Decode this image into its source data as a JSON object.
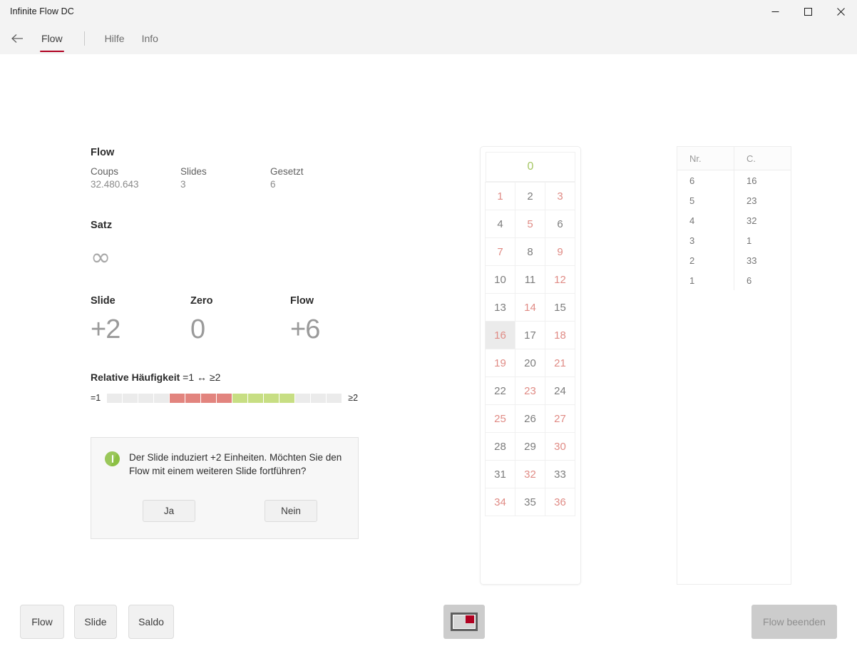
{
  "window": {
    "title": "Infinite Flow DC",
    "controls": [
      {
        "name": "minimize",
        "glyph": "minimize-icon"
      },
      {
        "name": "maximize",
        "glyph": "maximize-icon"
      },
      {
        "name": "close",
        "glyph": "close-icon"
      }
    ]
  },
  "nav": {
    "back_icon": "back-arrow-icon",
    "tabs": [
      {
        "label": "Flow",
        "active": true
      },
      {
        "label": "Hilfe",
        "active": false
      },
      {
        "label": "Info",
        "active": false
      }
    ],
    "accent_color": "#b00020"
  },
  "flow_section": {
    "title": "Flow",
    "stats": [
      {
        "label": "Coups",
        "value": "32.480.643"
      },
      {
        "label": "Slides",
        "value": "3"
      },
      {
        "label": "Gesetzt",
        "value": "6"
      }
    ]
  },
  "satz_section": {
    "title": "Satz",
    "value": "∞",
    "value_icon": "infinity-icon"
  },
  "metrics": [
    {
      "label": "Slide",
      "value": "+2"
    },
    {
      "label": "Zero",
      "value": "0"
    },
    {
      "label": "Flow",
      "value": "+6"
    }
  ],
  "frequency": {
    "title_bold": "Relative Häufigkeit",
    "title_rest": "=1 ↔ ≥2",
    "left_label": "=1",
    "right_label": "≥2",
    "segments": [
      "gray",
      "gray",
      "gray",
      "gray",
      "red",
      "red",
      "red",
      "red",
      "green",
      "green",
      "green",
      "green",
      "gray",
      "gray",
      "gray"
    ],
    "colors": {
      "gray": "#ebebeb",
      "red": "#e2847e",
      "green": "#c7de83"
    }
  },
  "dialog": {
    "icon": "info-icon",
    "message": "Der Slide induziert +2 Einheiten. Möchten Sie den Flow mit einem weiteren Slide fortführen?",
    "yes_label": "Ja",
    "no_label": "Nein"
  },
  "roulette": {
    "zero": {
      "value": "0",
      "color_class": "green"
    },
    "rows": [
      [
        {
          "value": "1",
          "color": "red"
        },
        {
          "value": "2",
          "color": "black"
        },
        {
          "value": "3",
          "color": "red"
        }
      ],
      [
        {
          "value": "4",
          "color": "black"
        },
        {
          "value": "5",
          "color": "red"
        },
        {
          "value": "6",
          "color": "black"
        }
      ],
      [
        {
          "value": "7",
          "color": "red"
        },
        {
          "value": "8",
          "color": "black"
        },
        {
          "value": "9",
          "color": "red"
        }
      ],
      [
        {
          "value": "10",
          "color": "black"
        },
        {
          "value": "11",
          "color": "black"
        },
        {
          "value": "12",
          "color": "red"
        }
      ],
      [
        {
          "value": "13",
          "color": "black"
        },
        {
          "value": "14",
          "color": "red"
        },
        {
          "value": "15",
          "color": "black"
        }
      ],
      [
        {
          "value": "16",
          "color": "red",
          "highlighted": true
        },
        {
          "value": "17",
          "color": "black"
        },
        {
          "value": "18",
          "color": "red"
        }
      ],
      [
        {
          "value": "19",
          "color": "red"
        },
        {
          "value": "20",
          "color": "black"
        },
        {
          "value": "21",
          "color": "red"
        }
      ],
      [
        {
          "value": "22",
          "color": "black"
        },
        {
          "value": "23",
          "color": "red"
        },
        {
          "value": "24",
          "color": "black"
        }
      ],
      [
        {
          "value": "25",
          "color": "red"
        },
        {
          "value": "26",
          "color": "black"
        },
        {
          "value": "27",
          "color": "red"
        }
      ],
      [
        {
          "value": "28",
          "color": "black"
        },
        {
          "value": "29",
          "color": "black"
        },
        {
          "value": "30",
          "color": "red"
        }
      ],
      [
        {
          "value": "31",
          "color": "black"
        },
        {
          "value": "32",
          "color": "red"
        },
        {
          "value": "33",
          "color": "black"
        }
      ],
      [
        {
          "value": "34",
          "color": "red"
        },
        {
          "value": "35",
          "color": "black"
        },
        {
          "value": "36",
          "color": "red"
        }
      ]
    ],
    "red_color": "#e08b85",
    "black_color": "#7c7c7c",
    "zero_color": "#a5c663"
  },
  "history": {
    "headers": [
      "Nr.",
      "C."
    ],
    "rows": [
      {
        "nr": "6",
        "c": "16"
      },
      {
        "nr": "5",
        "c": "23"
      },
      {
        "nr": "4",
        "c": "32"
      },
      {
        "nr": "3",
        "c": "1"
      },
      {
        "nr": "2",
        "c": "33"
      },
      {
        "nr": "1",
        "c": "6"
      }
    ]
  },
  "bottom_bar": {
    "flow_label": "Flow",
    "slide_label": "Slide",
    "saldo_label": "Saldo",
    "chip_icon": "table-chip-icon",
    "end_label": "Flow beenden",
    "end_disabled": true
  }
}
